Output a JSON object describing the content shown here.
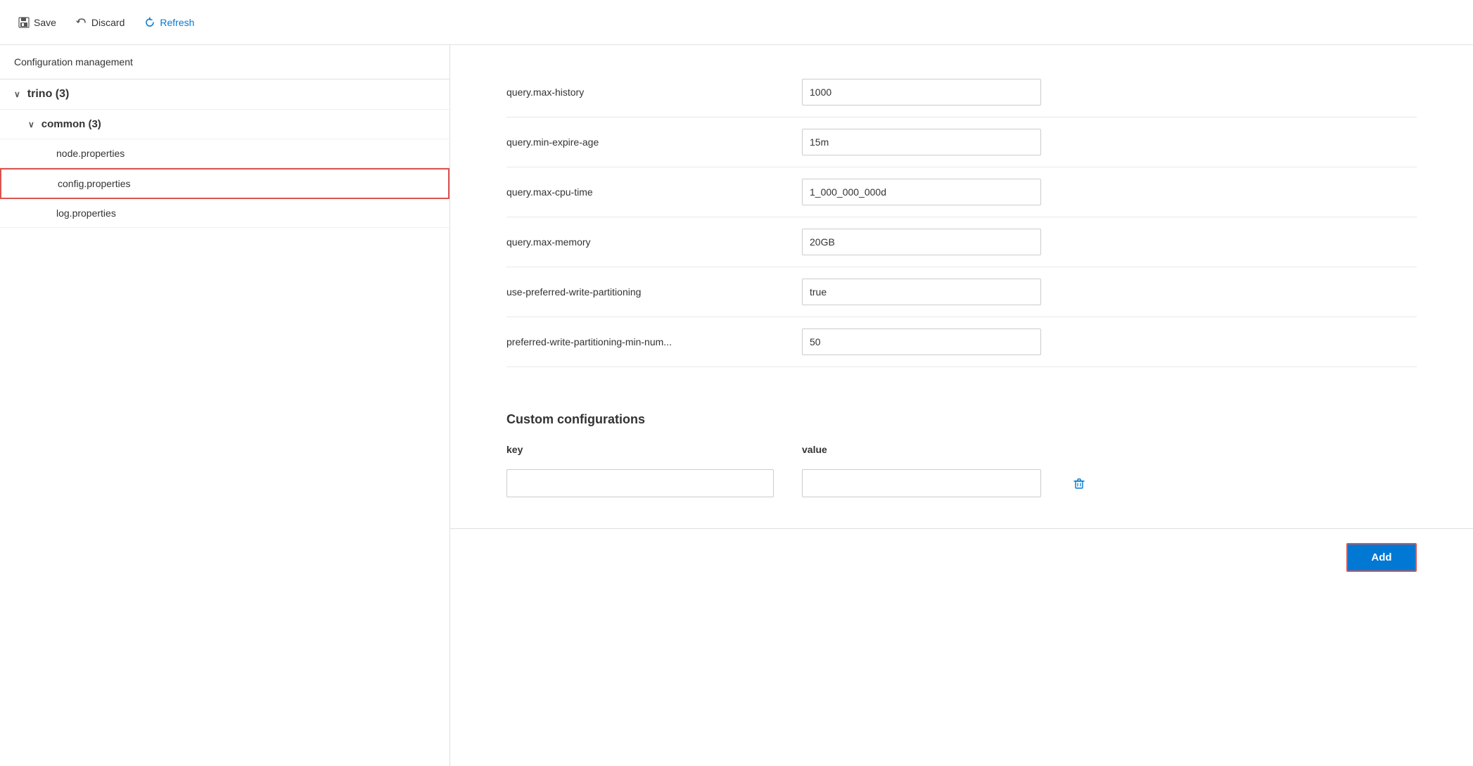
{
  "toolbar": {
    "save_label": "Save",
    "discard_label": "Discard",
    "refresh_label": "Refresh"
  },
  "sidebar": {
    "title": "Configuration management",
    "tree": [
      {
        "id": "trino",
        "label": "trino (3)",
        "level": 0,
        "expanded": true,
        "chevron": "∨"
      },
      {
        "id": "common",
        "label": "common (3)",
        "level": 1,
        "expanded": true,
        "chevron": "∨"
      },
      {
        "id": "node-properties",
        "label": "node.properties",
        "level": 2,
        "selected": false
      },
      {
        "id": "config-properties",
        "label": "config.properties",
        "level": 2,
        "selected": true
      },
      {
        "id": "log-properties",
        "label": "log.properties",
        "level": 2,
        "selected": false
      }
    ]
  },
  "config": {
    "rows": [
      {
        "key": "query.max-history",
        "value": "1000"
      },
      {
        "key": "query.min-expire-age",
        "value": "15m"
      },
      {
        "key": "query.max-cpu-time",
        "value": "1_000_000_000d"
      },
      {
        "key": "query.max-memory",
        "value": "20GB"
      },
      {
        "key": "use-preferred-write-partitioning",
        "value": "true"
      },
      {
        "key": "preferred-write-partitioning-min-num...",
        "value": "50"
      }
    ]
  },
  "custom_configurations": {
    "title": "Custom configurations",
    "key_label": "key",
    "value_label": "value",
    "rows": [
      {
        "key": "",
        "value": ""
      }
    ],
    "add_label": "Add"
  },
  "icons": {
    "save": "💾",
    "discard": "↩",
    "refresh": "↻",
    "delete": "🗑",
    "chevron_down": "∨"
  }
}
